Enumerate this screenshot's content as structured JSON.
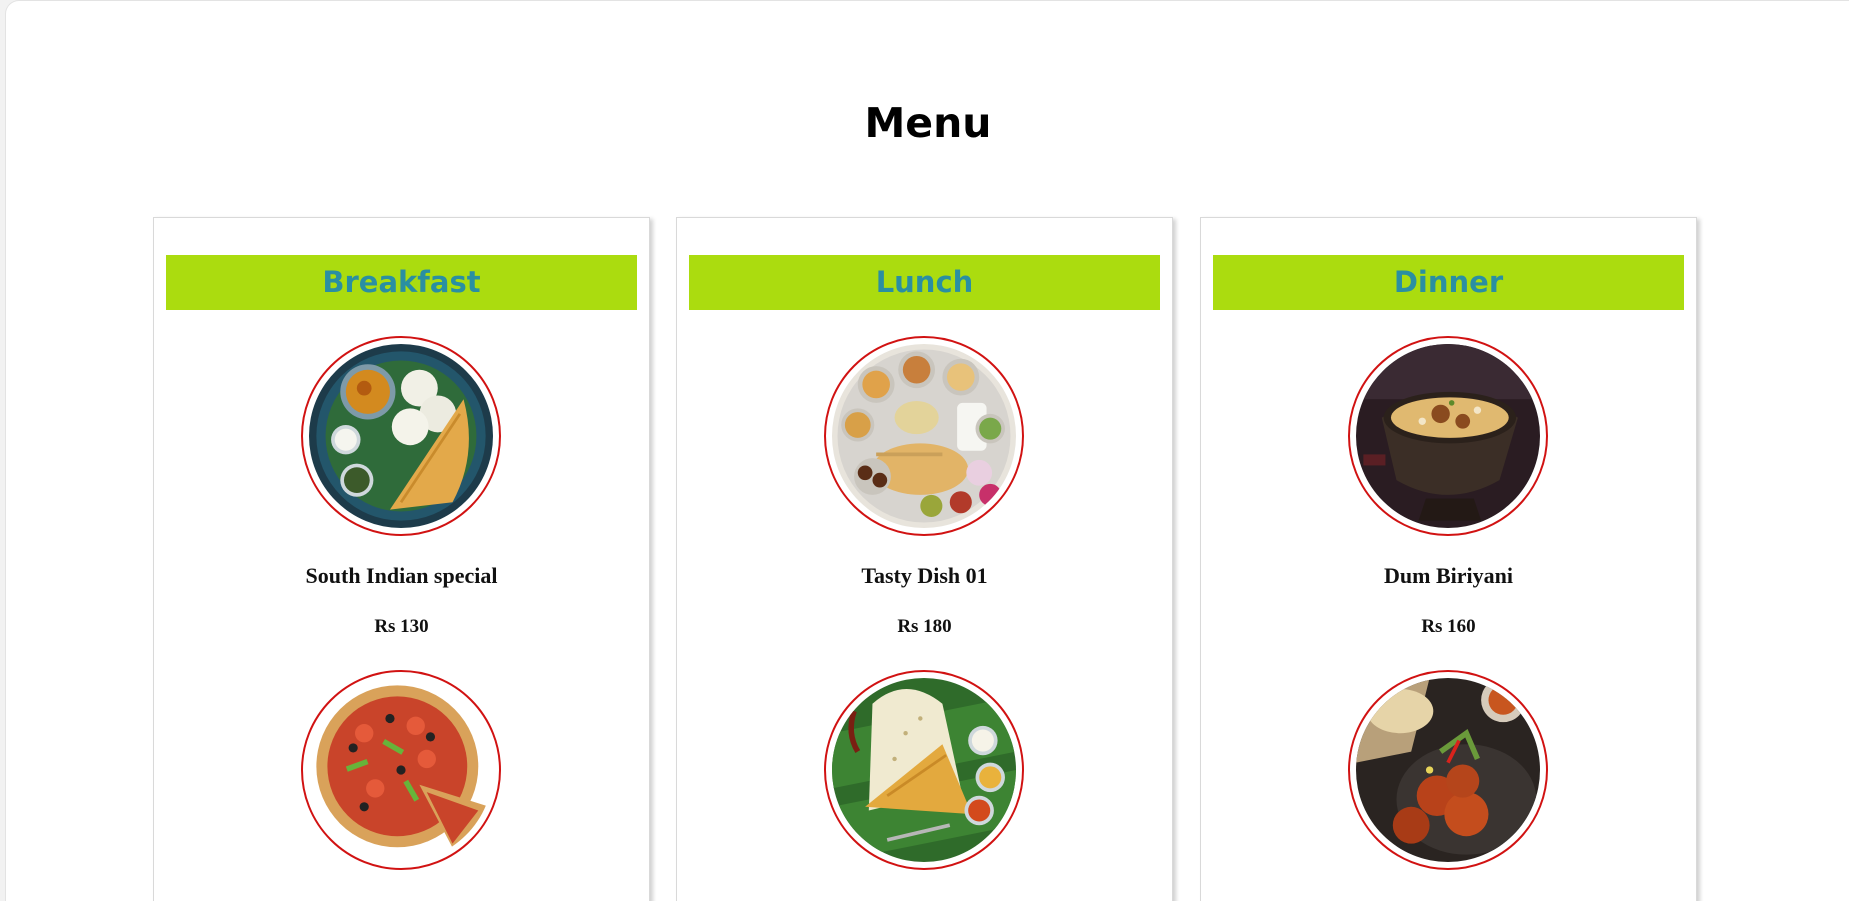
{
  "page": {
    "title": "Menu"
  },
  "sections": [
    {
      "title": "Breakfast",
      "items": [
        {
          "name": "South Indian special",
          "price": "Rs 130",
          "image": "idli-dosa-plate"
        },
        {
          "image": "pizza"
        }
      ]
    },
    {
      "title": "Lunch",
      "items": [
        {
          "name": "Tasty Dish 01",
          "price": "Rs 180",
          "image": "thali-plate"
        },
        {
          "image": "masala-dosa-on-banana-leaf"
        }
      ]
    },
    {
      "title": "Dinner",
      "items": [
        {
          "name": "Dum Biriyani",
          "price": "Rs 160",
          "image": "biriyani-bowl"
        },
        {
          "image": "chicken-tikka-with-naan"
        }
      ]
    }
  ],
  "colors": {
    "header_bg": "#abdc0f",
    "header_text": "#2a8fa2",
    "image_ring": "#d11212"
  }
}
